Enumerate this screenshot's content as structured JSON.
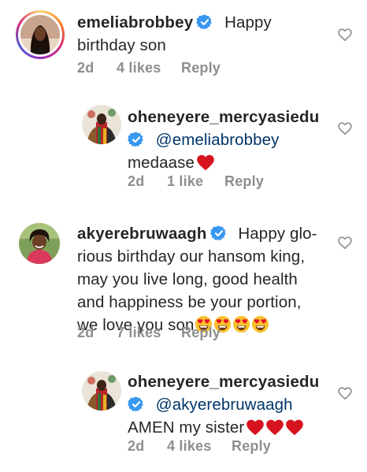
{
  "comments": [
    {
      "username": "emeliabrobbey",
      "text_line1": "Happy",
      "text_line2": "birthday son",
      "time": "2d",
      "likes": "4 likes",
      "reply": "Reply",
      "reply_comment": false
    },
    {
      "username": "oheneyere_mercyasiedu",
      "mention": "@emeliabrobbey",
      "text": "medaase",
      "time": "2d",
      "likes": "1 like",
      "reply": "Reply",
      "reply_comment": true
    },
    {
      "username": "akyerebruwaagh",
      "text_line1": "Happy glo-",
      "text_line2": "rious birthday our hansom king,",
      "text_line3": "may you live long, good health",
      "text_line4": "and happiness be your portion,",
      "text_line5": "we love you son",
      "time": "2d",
      "likes": "7 likes",
      "reply": "Reply",
      "reply_comment": false
    },
    {
      "username": "oheneyere_mercyasiedu",
      "mention": "@akyerebruwaagh",
      "text": "AMEN my sister",
      "time": "2d",
      "likes": "4 likes",
      "reply": "Reply",
      "reply_comment": true
    }
  ],
  "icons": {
    "verified": "verified-badge-icon",
    "like": "heart-outline-icon",
    "emoji": "heart-eyes-emoji",
    "red_heart": "red-heart-emoji"
  },
  "colors": {
    "verified_blue": "#3897f0",
    "mention": "#003569",
    "meta_gray": "#8e8e8e",
    "heart_red": "#e0102a",
    "text": "#262626"
  }
}
